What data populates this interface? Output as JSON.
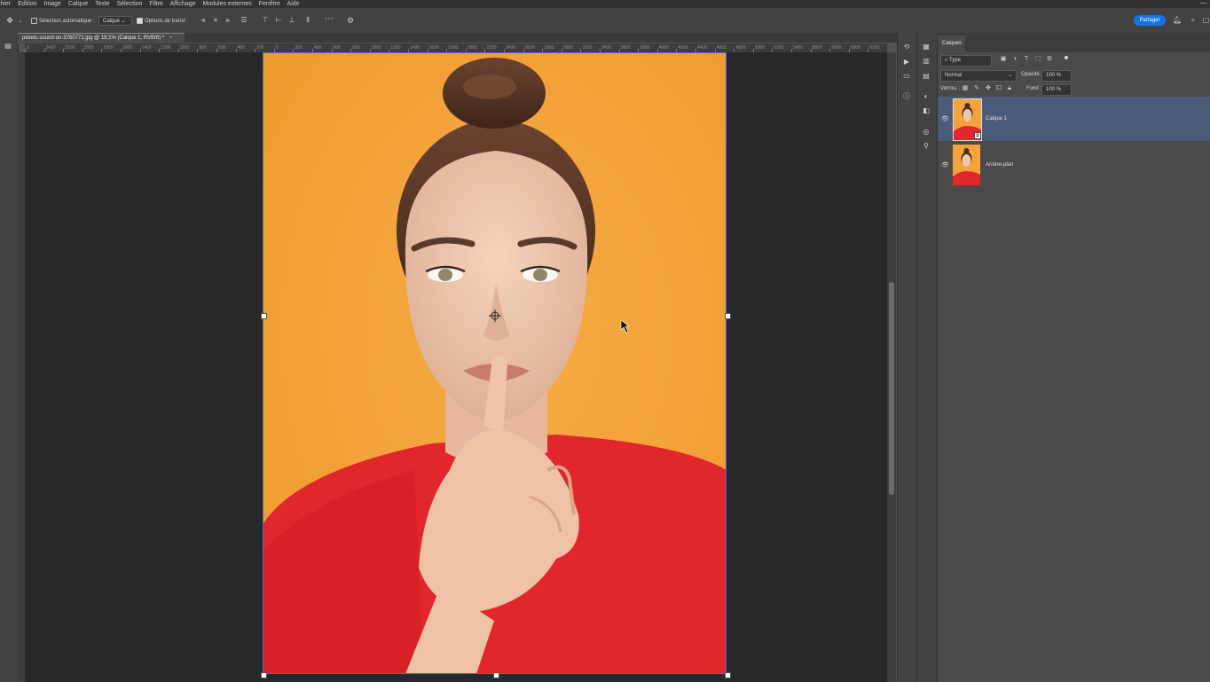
{
  "menu": [
    "chier",
    "Edition",
    "Image",
    "Calque",
    "Texte",
    "Sélection",
    "Filtre",
    "Affichage",
    "Modules externes",
    "Fenêtre",
    "Aide"
  ],
  "window_controls": "—",
  "options": {
    "auto_select_label": "Sélection automatique :",
    "auto_select_value": "Calque",
    "transform_label": "Options de transf.",
    "more_icon": "⋯",
    "share_label": "Partager"
  },
  "document": {
    "tab_title": "pexels-sound-on-3760771.jpg @ 19,1% (Calque 1, RVB/8) *",
    "close_icon": "×"
  },
  "ruler_ticks": [
    "0",
    "2400",
    "2200",
    "2000",
    "1800",
    "1600",
    "1400",
    "1200",
    "1000",
    "800",
    "600",
    "400",
    "200",
    "0",
    "200",
    "400",
    "600",
    "800",
    "1000",
    "1200",
    "1400",
    "1600",
    "1800",
    "2000",
    "2200",
    "2400",
    "2600",
    "2800",
    "3000",
    "3200",
    "3400",
    "3600",
    "3800",
    "4000",
    "4200",
    "4400",
    "4600",
    "4800",
    "5000",
    "5200",
    "5400",
    "5600",
    "5800",
    "6000",
    "6200"
  ],
  "layers_panel": {
    "tab": "Calques",
    "filter_kind": "Type",
    "blend_mode": "Normal",
    "opacity_label": "Opacité :",
    "opacity_value": "100 %",
    "lock_label": "Verrou. :",
    "fill_label": "Fond :",
    "fill_value": "100 %",
    "layers": [
      {
        "name": "Calque 1",
        "selected": true
      },
      {
        "name": "Arrière-plan",
        "selected": false
      }
    ]
  },
  "colors": {
    "background_orange": "#f4a23a",
    "shirt_red": "#e1262c",
    "selection_blue": "#4b5b7a",
    "accent": "#1473e6"
  }
}
